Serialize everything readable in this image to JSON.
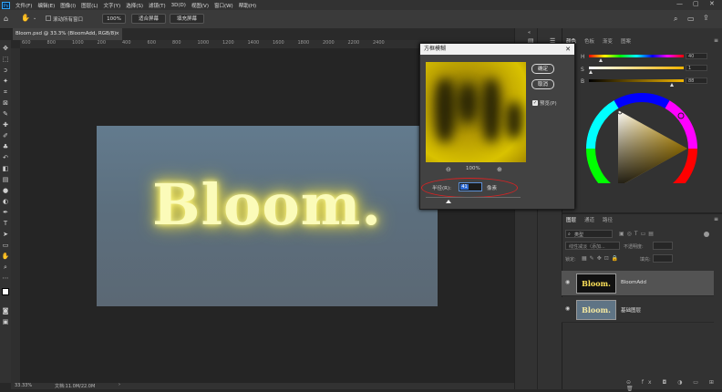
{
  "menubar": {
    "logo": "Ps",
    "items": [
      "文件(F)",
      "编辑(E)",
      "图像(I)",
      "图层(L)",
      "文字(Y)",
      "选择(S)",
      "滤镜(T)",
      "3D(D)",
      "视图(V)",
      "窗口(W)",
      "帮助(H)"
    ]
  },
  "options": {
    "scroll_all_windows": "滚动所有窗口",
    "zoom_value": "100%",
    "fit_screen": "适合屏幕",
    "fill_screen": "填充屏幕"
  },
  "document": {
    "tab_title": "Bloom.psd @ 33.3% (BloomAdd, RGB/8)",
    "canvas_text": "Bloom.",
    "ruler_marks": [
      "600",
      "800",
      "1000",
      "200",
      "400",
      "600",
      "800",
      "1000",
      "1200",
      "1400",
      "1600",
      "1800",
      "2000",
      "2200",
      "2400"
    ]
  },
  "status": {
    "zoom": "33.33%",
    "doc_info": "文档:11.0M/22.0M"
  },
  "dialog": {
    "title": "方框模糊",
    "ok": "确定",
    "cancel": "取消",
    "preview_label": "预览(P)",
    "preview_checked": true,
    "zoom": "100%",
    "radius_label": "半径(R):",
    "radius_value": "41",
    "radius_unit": "像素"
  },
  "color_panel": {
    "tabs": [
      "颜色",
      "色板",
      "渐变",
      "图案"
    ],
    "values": [
      "40",
      "1",
      "88"
    ],
    "accent": "#f0b400"
  },
  "layers_panel": {
    "tabs": [
      "图层",
      "通道",
      "路径"
    ],
    "filter_kind": "类型",
    "blend_mode": "线性减淡（添加...",
    "opacity_label": "不透明度:",
    "lock_label": "锁定:",
    "fill_label": "填充:",
    "layers": [
      {
        "name": "BloomAdd",
        "thumb_text": "Bloom.",
        "selected": true
      },
      {
        "name": "基础图层",
        "thumb_text": "Bloom.",
        "selected": false
      }
    ]
  }
}
